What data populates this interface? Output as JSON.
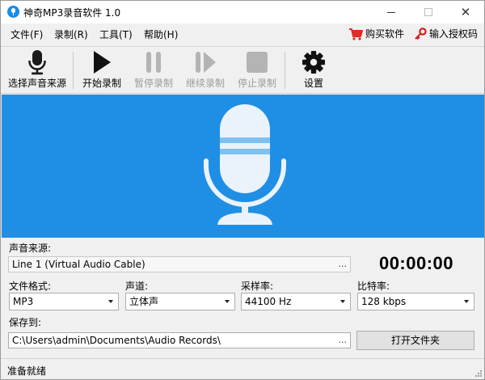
{
  "window": {
    "title": "神奇MP3录音软件 1.0"
  },
  "menu": {
    "file": "文件(F)",
    "record": "录制(R)",
    "tools": "工具(T)",
    "help": "帮助(H)",
    "buy": "购买软件",
    "register": "输入授权码"
  },
  "toolbar": {
    "select_source": "选择声音来源",
    "start": "开始录制",
    "pause": "暂停录制",
    "resume": "继续录制",
    "stop": "停止录制",
    "settings": "设置"
  },
  "source": {
    "label": "声音来源:",
    "value": "Line 1 (Virtual Audio Cable)",
    "browse": "..."
  },
  "timer": "00:00:00",
  "format": {
    "label": "文件格式:",
    "value": "MP3"
  },
  "channels": {
    "label": "声道:",
    "value": "立体声"
  },
  "sample_rate": {
    "label": "采样率:",
    "value": "44100 Hz"
  },
  "bitrate": {
    "label": "比特率:",
    "value": "128 kbps"
  },
  "save": {
    "label": "保存到:",
    "path": "C:\\Users\\admin\\Documents\\Audio Records\\",
    "browse": "...",
    "open_folder": "打开文件夹"
  },
  "status": "准备就绪",
  "colors": {
    "banner": "#1f8fe5",
    "disabled_text": "#9b9b9b",
    "cart_red": "#e02a22"
  }
}
